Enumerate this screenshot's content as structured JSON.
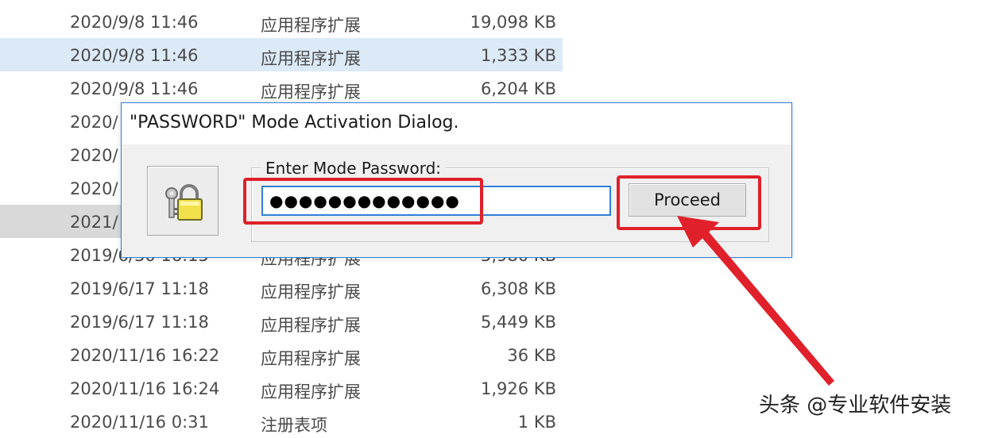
{
  "files": [
    {
      "date": "2020/9/8 11:46",
      "type": "应用程序扩展",
      "size": "19,098 KB",
      "state": "normal"
    },
    {
      "date": "2020/9/8 11:46",
      "type": "应用程序扩展",
      "size": "1,333 KB",
      "state": "selected"
    },
    {
      "date": "2020/9/8 11:46",
      "type": "应用程序扩展",
      "size": "6,204 KB",
      "state": "normal"
    },
    {
      "date": "2020/",
      "type": "",
      "size": "",
      "state": "normal"
    },
    {
      "date": "2020/",
      "type": "",
      "size": "",
      "state": "normal"
    },
    {
      "date": "2020/",
      "type": "",
      "size": "",
      "state": "normal"
    },
    {
      "date": "2021/",
      "type": "",
      "size": "",
      "state": "hover"
    },
    {
      "date": "2019/6/30 16:15",
      "type": "应用程序扩展",
      "size": "5,980 KB",
      "state": "normal"
    },
    {
      "date": "2019/6/17 11:18",
      "type": "应用程序扩展",
      "size": "6,308 KB",
      "state": "normal"
    },
    {
      "date": "2019/6/17 11:18",
      "type": "应用程序扩展",
      "size": "5,449 KB",
      "state": "normal"
    },
    {
      "date": "2020/11/16 16:22",
      "type": "应用程序扩展",
      "size": "36 KB",
      "state": "normal"
    },
    {
      "date": "2020/11/16 16:24",
      "type": "应用程序扩展",
      "size": "1,926 KB",
      "state": "normal"
    },
    {
      "date": "2020/11/16 0:31",
      "type": "注册表项",
      "size": "1 KB",
      "state": "normal"
    }
  ],
  "dialog": {
    "title": "\"PASSWORD\" Mode Activation Dialog.",
    "group_label": "Enter Mode Password:",
    "password_value": "●●●●●●●●●●●●●",
    "proceed_label": "Proceed",
    "icon": "padlock-keys-icon"
  },
  "annotation": {
    "color": "#e0202a",
    "watermark": "头条 @专业软件安装"
  }
}
